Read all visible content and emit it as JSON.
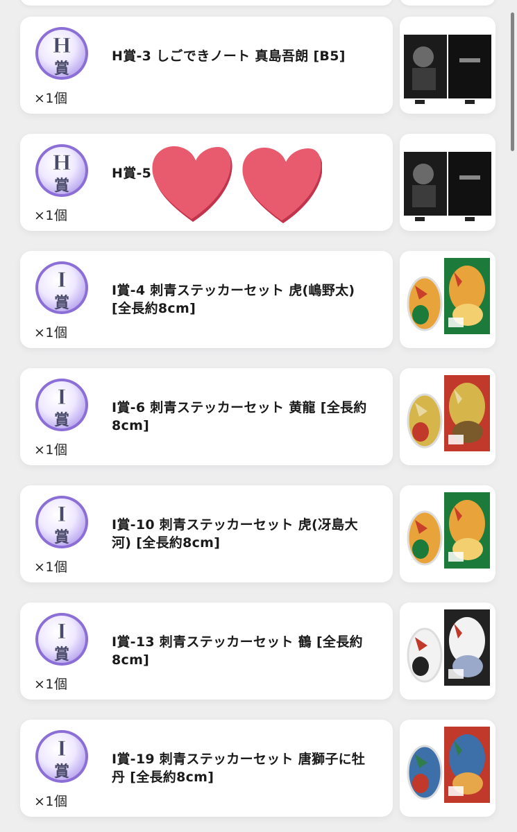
{
  "prizes": [
    {
      "grade": "H",
      "badge_label": "H賞",
      "title": "H賞-3 しごできノート 真島吾朗 [B5]",
      "qty": "×1個",
      "thumb_icon": "notebook-majima-image"
    },
    {
      "grade": "H",
      "badge_label": "H賞",
      "title": "H賞-5",
      "qty": "×1個",
      "thumb_icon": "notebook-image"
    },
    {
      "grade": "I",
      "badge_label": "I賞",
      "title": "I賞-4 刺青ステッカーセット 虎(嶋野太) [全長約8cm]",
      "qty": "×1個",
      "thumb_icon": "tiger-sticker-image"
    },
    {
      "grade": "I",
      "badge_label": "I賞",
      "title": "I賞-6 刺青ステッカーセット 黄龍 [全長約8cm]",
      "qty": "×1個",
      "thumb_icon": "dragon-sticker-image"
    },
    {
      "grade": "I",
      "badge_label": "I賞",
      "title": "I賞-10 刺青ステッカーセット 虎(冴島大河) [全長約8cm]",
      "qty": "×1個",
      "thumb_icon": "tiger-sticker-image"
    },
    {
      "grade": "I",
      "badge_label": "I賞",
      "title": "I賞-13 刺青ステッカーセット 鶴 [全長約8cm]",
      "qty": "×1個",
      "thumb_icon": "crane-sticker-image"
    },
    {
      "grade": "I",
      "badge_label": "I賞",
      "title": "I賞-19 刺青ステッカーセット 唐獅子に牡丹 [全長約8cm]",
      "qty": "×1個",
      "thumb_icon": "lion-sticker-image"
    }
  ],
  "overlay": {
    "icon": "heart-sticker-icon",
    "color": "#e85a6e"
  },
  "colors": {
    "badge_purple": "#8c6fd6",
    "background": "#eeeeef"
  }
}
